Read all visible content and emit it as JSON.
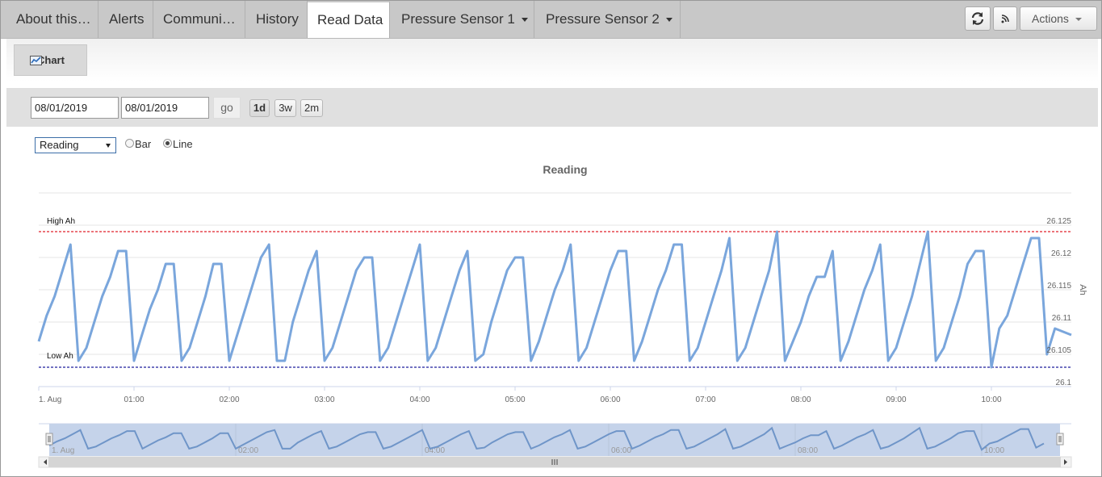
{
  "tabs": [
    {
      "label": "About this…",
      "active": false
    },
    {
      "label": "Alerts",
      "active": false
    },
    {
      "label": "Communi…",
      "active": false
    },
    {
      "label": "History",
      "active": false
    },
    {
      "label": "Read Data",
      "active": true
    },
    {
      "label": "Pressure Sensor 1",
      "active": false,
      "dropdown": true
    },
    {
      "label": "Pressure Sensor 2",
      "active": false,
      "dropdown": true
    }
  ],
  "toolbar": {
    "refresh_icon": "refresh-icon",
    "rss_icon": "rss-icon",
    "actions_label": "Actions"
  },
  "subtabs": {
    "chart_label": "Chart",
    "chart_icon": "line-chart-icon"
  },
  "date_range": {
    "start": "08/01/2019",
    "end": "08/01/2019",
    "go_label": "go",
    "ranges": [
      "1d",
      "3w",
      "2m"
    ],
    "selected_range": "1d"
  },
  "series_select": {
    "selected": "Reading"
  },
  "chart_type_options": [
    {
      "label": "Bar",
      "checked": false
    },
    {
      "label": "Line",
      "checked": true
    }
  ],
  "colors": {
    "series": "#7aa6dc",
    "high_line": "#e0212b",
    "low_line": "#1f1f9e",
    "navigator_fill": "#c5d3ea"
  },
  "chart_data": {
    "type": "line",
    "title": "Reading",
    "ylabel": "Ah",
    "ylim": [
      26.1,
      26.125
    ],
    "yticks": [
      "26.1",
      "26.105",
      "26.11",
      "26.115",
      "26.12",
      "26.125"
    ],
    "xlim": [
      "00:00",
      "10:50"
    ],
    "xticks": [
      "1. Aug",
      "01:00",
      "02:00",
      "03:00",
      "04:00",
      "05:00",
      "06:00",
      "07:00",
      "08:00",
      "09:00",
      "10:00"
    ],
    "grid": true,
    "plot_lines": [
      {
        "label": "High Ah",
        "value": 26.124
      },
      {
        "label": "Low Ah",
        "value": 26.103
      }
    ],
    "series": [
      {
        "points": [
          [
            "00:00",
            26.107
          ],
          [
            "00:05",
            26.111
          ],
          [
            "00:10",
            26.114
          ],
          [
            "00:15",
            26.118
          ],
          [
            "00:20",
            26.122
          ],
          [
            "00:25",
            26.104
          ],
          [
            "00:30",
            26.106
          ],
          [
            "00:35",
            26.11
          ],
          [
            "00:40",
            26.114
          ],
          [
            "00:45",
            26.117
          ],
          [
            "00:50",
            26.121
          ],
          [
            "00:55",
            26.121
          ],
          [
            "01:00",
            26.104
          ],
          [
            "01:05",
            26.108
          ],
          [
            "01:10",
            26.112
          ],
          [
            "01:15",
            26.115
          ],
          [
            "01:20",
            26.119
          ],
          [
            "01:25",
            26.119
          ],
          [
            "01:30",
            26.104
          ],
          [
            "01:35",
            26.106
          ],
          [
            "01:40",
            26.11
          ],
          [
            "01:45",
            26.114
          ],
          [
            "01:50",
            26.119
          ],
          [
            "01:55",
            26.119
          ],
          [
            "02:00",
            26.104
          ],
          [
            "02:05",
            26.108
          ],
          [
            "02:10",
            26.112
          ],
          [
            "02:15",
            26.116
          ],
          [
            "02:20",
            26.12
          ],
          [
            "02:25",
            26.122
          ],
          [
            "02:30",
            26.104
          ],
          [
            "02:35",
            26.104
          ],
          [
            "02:40",
            26.11
          ],
          [
            "02:45",
            26.114
          ],
          [
            "02:50",
            26.118
          ],
          [
            "02:55",
            26.121
          ],
          [
            "03:00",
            26.104
          ],
          [
            "03:05",
            26.106
          ],
          [
            "03:10",
            26.11
          ],
          [
            "03:15",
            26.114
          ],
          [
            "03:20",
            26.118
          ],
          [
            "03:25",
            26.12
          ],
          [
            "03:30",
            26.12
          ],
          [
            "03:35",
            26.104
          ],
          [
            "03:40",
            26.106
          ],
          [
            "03:45",
            26.11
          ],
          [
            "03:50",
            26.114
          ],
          [
            "03:55",
            26.118
          ],
          [
            "04:00",
            26.122
          ],
          [
            "04:05",
            26.104
          ],
          [
            "04:10",
            26.106
          ],
          [
            "04:15",
            26.11
          ],
          [
            "04:20",
            26.114
          ],
          [
            "04:25",
            26.118
          ],
          [
            "04:30",
            26.121
          ],
          [
            "04:35",
            26.104
          ],
          [
            "04:40",
            26.105
          ],
          [
            "04:45",
            26.11
          ],
          [
            "04:50",
            26.114
          ],
          [
            "04:55",
            26.118
          ],
          [
            "05:00",
            26.12
          ],
          [
            "05:05",
            26.12
          ],
          [
            "05:10",
            26.104
          ],
          [
            "05:15",
            26.107
          ],
          [
            "05:20",
            26.111
          ],
          [
            "05:25",
            26.115
          ],
          [
            "05:30",
            26.118
          ],
          [
            "05:35",
            26.122
          ],
          [
            "05:40",
            26.104
          ],
          [
            "05:45",
            26.106
          ],
          [
            "05:50",
            26.11
          ],
          [
            "05:55",
            26.114
          ],
          [
            "06:00",
            26.118
          ],
          [
            "06:05",
            26.121
          ],
          [
            "06:10",
            26.121
          ],
          [
            "06:15",
            26.104
          ],
          [
            "06:20",
            26.107
          ],
          [
            "06:25",
            26.111
          ],
          [
            "06:30",
            26.115
          ],
          [
            "06:35",
            26.118
          ],
          [
            "06:40",
            26.122
          ],
          [
            "06:45",
            26.122
          ],
          [
            "06:50",
            26.104
          ],
          [
            "06:55",
            26.106
          ],
          [
            "07:00",
            26.11
          ],
          [
            "07:05",
            26.114
          ],
          [
            "07:10",
            26.118
          ],
          [
            "07:15",
            26.123
          ],
          [
            "07:20",
            26.104
          ],
          [
            "07:25",
            26.106
          ],
          [
            "07:30",
            26.11
          ],
          [
            "07:35",
            26.114
          ],
          [
            "07:40",
            26.118
          ],
          [
            "07:45",
            26.124
          ],
          [
            "07:50",
            26.104
          ],
          [
            "07:55",
            26.107
          ],
          [
            "08:00",
            26.11
          ],
          [
            "08:05",
            26.114
          ],
          [
            "08:10",
            26.117
          ],
          [
            "08:15",
            26.117
          ],
          [
            "08:20",
            26.121
          ],
          [
            "08:25",
            26.104
          ],
          [
            "08:30",
            26.107
          ],
          [
            "08:35",
            26.111
          ],
          [
            "08:40",
            26.115
          ],
          [
            "08:45",
            26.118
          ],
          [
            "08:50",
            26.122
          ],
          [
            "08:55",
            26.104
          ],
          [
            "09:00",
            26.106
          ],
          [
            "09:05",
            26.11
          ],
          [
            "09:10",
            26.114
          ],
          [
            "09:15",
            26.119
          ],
          [
            "09:20",
            26.124
          ],
          [
            "09:25",
            26.104
          ],
          [
            "09:30",
            26.106
          ],
          [
            "09:35",
            26.11
          ],
          [
            "09:40",
            26.114
          ],
          [
            "09:45",
            26.119
          ],
          [
            "09:50",
            26.121
          ],
          [
            "09:55",
            26.121
          ],
          [
            "10:00",
            26.103
          ],
          [
            "10:05",
            26.109
          ],
          [
            "10:10",
            26.111
          ],
          [
            "10:15",
            26.115
          ],
          [
            "10:20",
            26.119
          ],
          [
            "10:25",
            26.123
          ],
          [
            "10:30",
            26.123
          ],
          [
            "10:35",
            26.105
          ],
          [
            "10:40",
            26.109
          ]
        ]
      }
    ],
    "navigator": {
      "xticks": [
        "1. Aug",
        "02:00",
        "04:00",
        "06:00",
        "08:00",
        "10:00"
      ]
    }
  }
}
